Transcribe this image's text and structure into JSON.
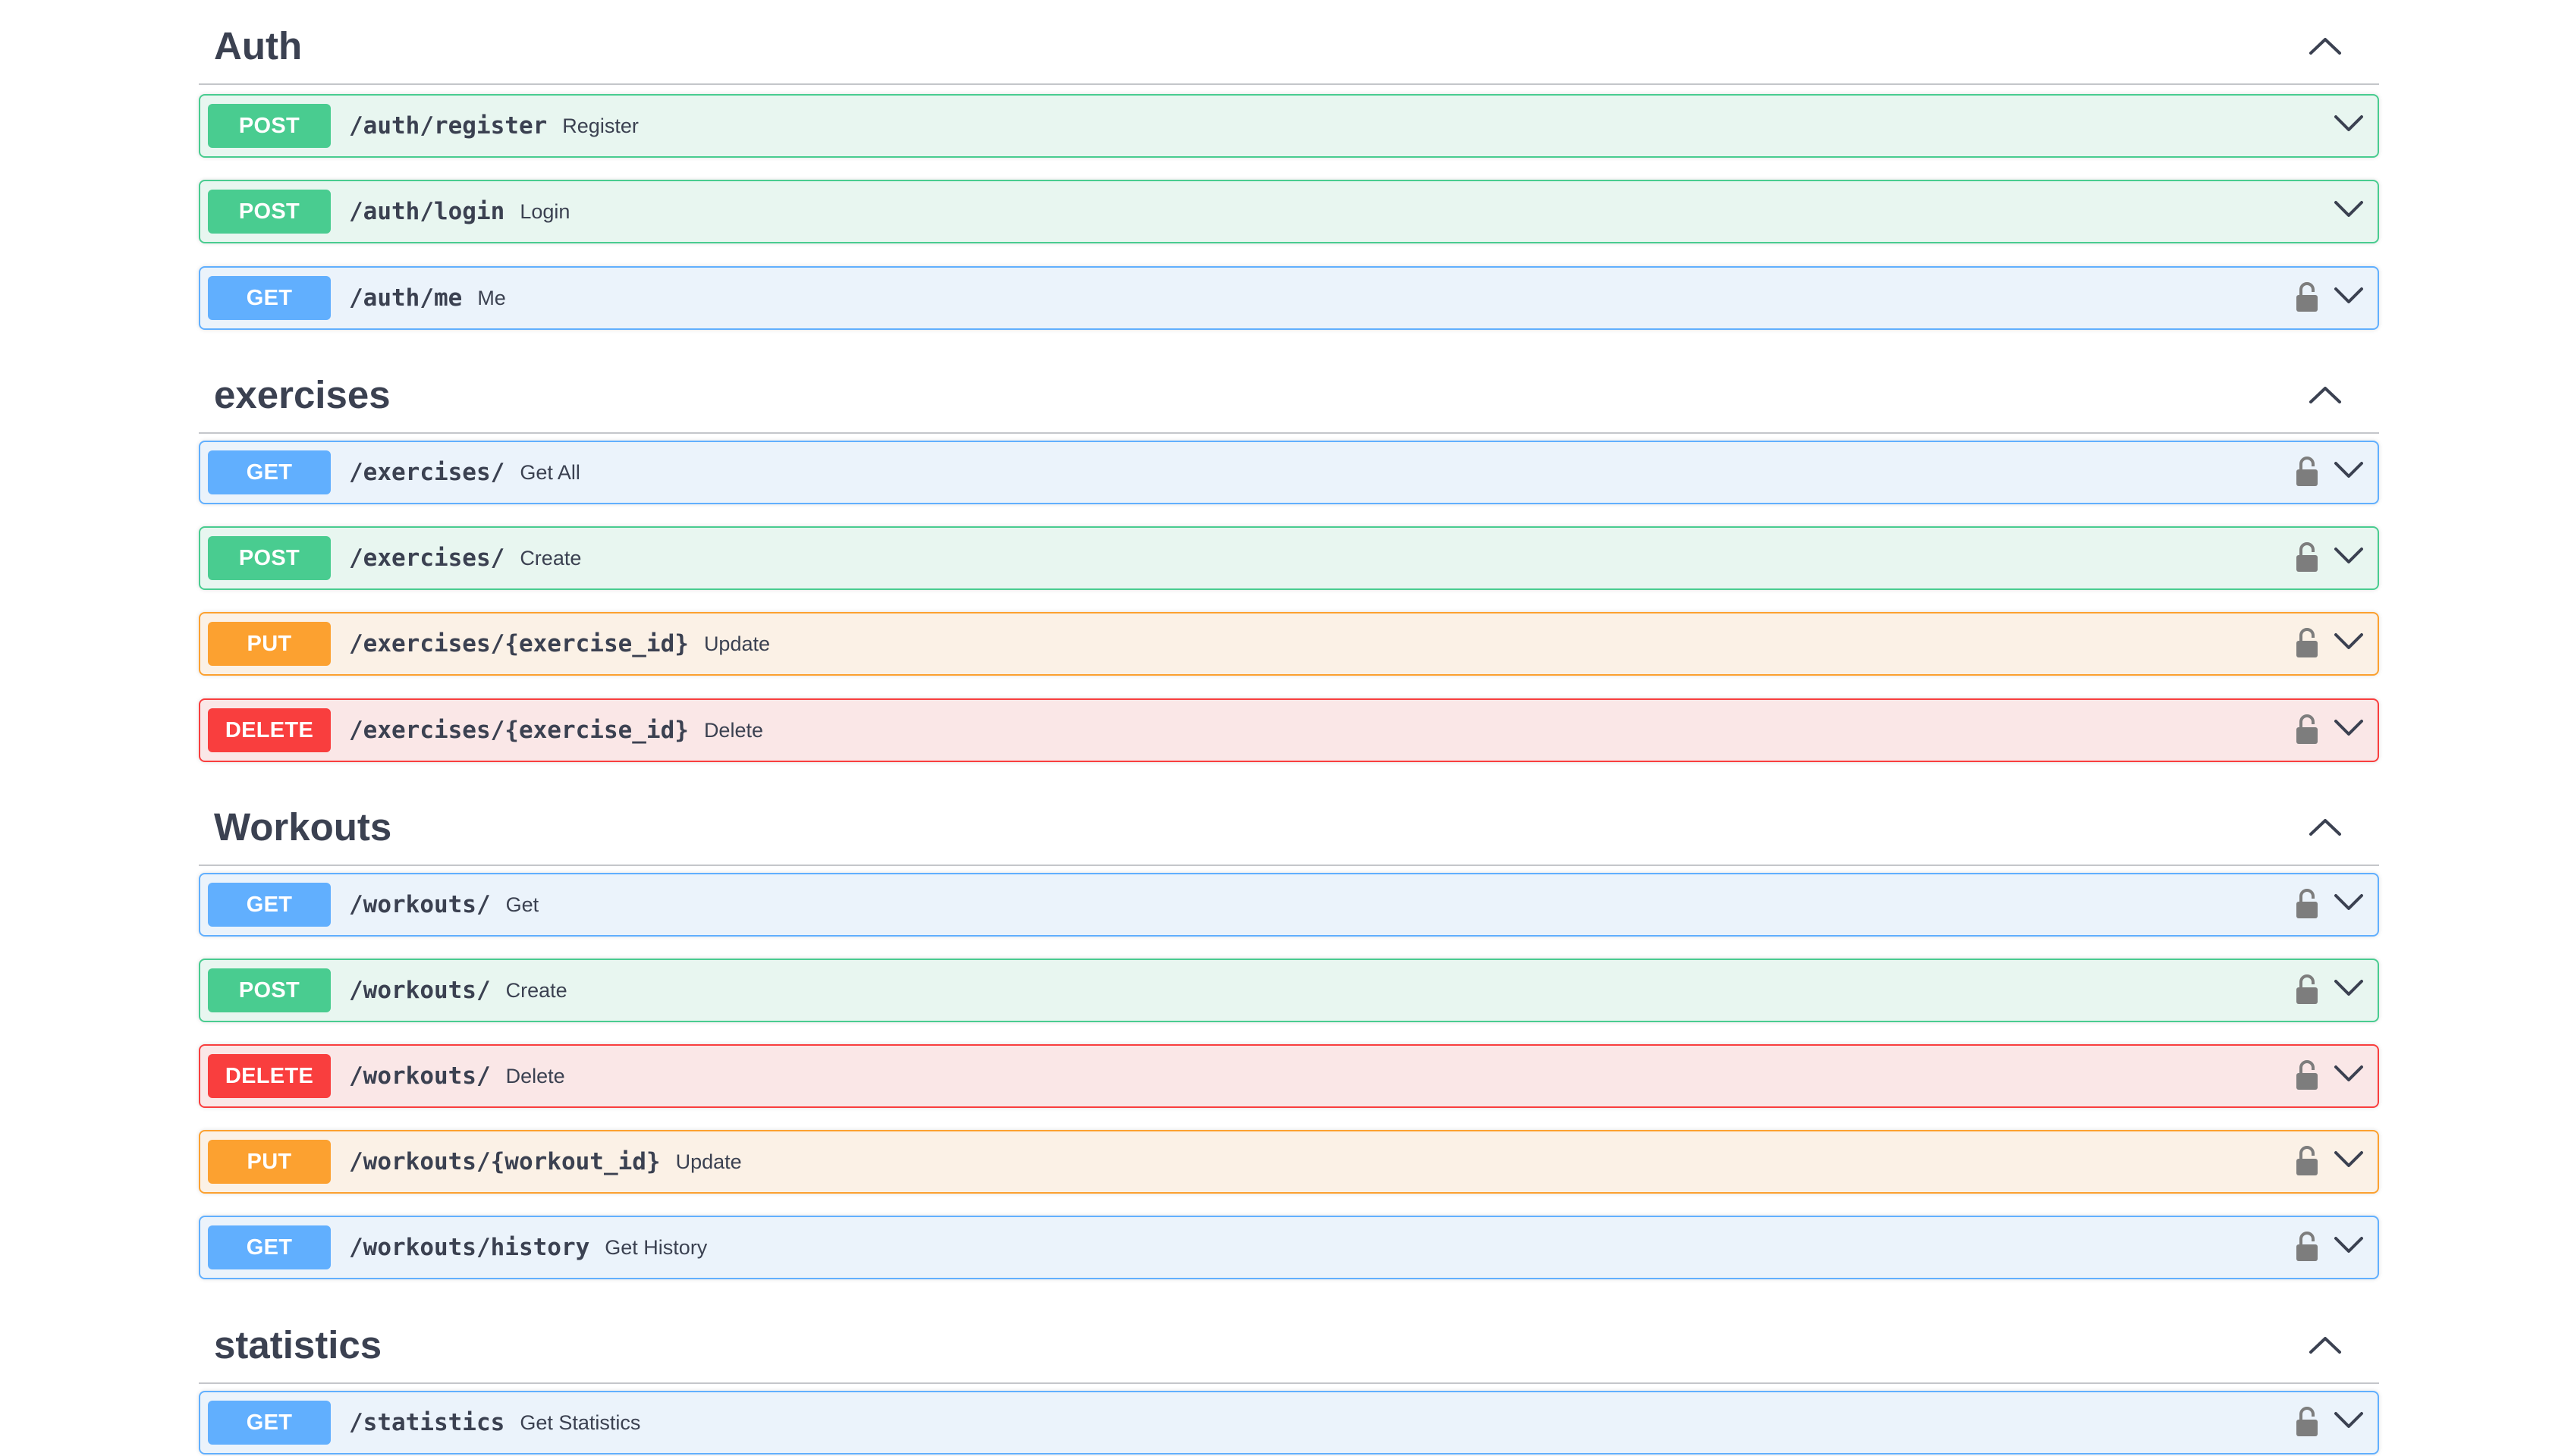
{
  "sections": [
    {
      "title": "Auth",
      "operations": [
        {
          "method": "POST",
          "path": "/auth/register",
          "summary": "Register",
          "locked": false
        },
        {
          "method": "POST",
          "path": "/auth/login",
          "summary": "Login",
          "locked": false
        },
        {
          "method": "GET",
          "path": "/auth/me",
          "summary": "Me",
          "locked": true
        }
      ]
    },
    {
      "title": "exercises",
      "operations": [
        {
          "method": "GET",
          "path": "/exercises/",
          "summary": "Get All",
          "locked": true
        },
        {
          "method": "POST",
          "path": "/exercises/",
          "summary": "Create",
          "locked": true
        },
        {
          "method": "PUT",
          "path": "/exercises/{exercise_id}",
          "summary": "Update",
          "locked": true
        },
        {
          "method": "DELETE",
          "path": "/exercises/{exercise_id}",
          "summary": "Delete",
          "locked": true
        }
      ]
    },
    {
      "title": "Workouts",
      "operations": [
        {
          "method": "GET",
          "path": "/workouts/",
          "summary": "Get",
          "locked": true
        },
        {
          "method": "POST",
          "path": "/workouts/",
          "summary": "Create",
          "locked": true
        },
        {
          "method": "DELETE",
          "path": "/workouts/",
          "summary": "Delete",
          "locked": true
        },
        {
          "method": "PUT",
          "path": "/workouts/{workout_id}",
          "summary": "Update",
          "locked": true
        },
        {
          "method": "GET",
          "path": "/workouts/history",
          "summary": "Get History",
          "locked": true
        }
      ]
    },
    {
      "title": "statistics",
      "operations": [
        {
          "method": "GET",
          "path": "/statistics",
          "summary": "Get Statistics",
          "locked": true
        }
      ]
    }
  ],
  "icons": {
    "section_toggle": "chevron-up-icon",
    "expand": "chevron-down-icon",
    "auth": "lock-icon"
  },
  "colors": {
    "get": "#61affe",
    "post": "#49cc90",
    "put": "#fca130",
    "delete": "#f93e3e",
    "text": "#3b4151"
  }
}
